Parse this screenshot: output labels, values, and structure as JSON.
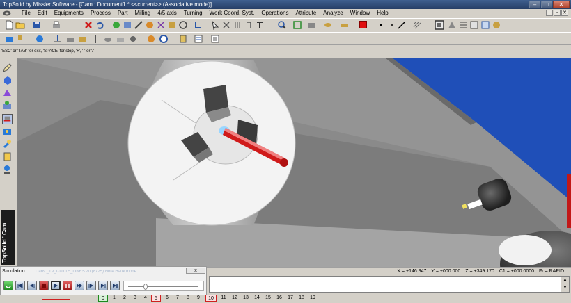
{
  "window": {
    "title": "TopSolid by Missler Software - [Cam : Document1 *  <<current>> (Associative mode)]"
  },
  "menu": [
    "File",
    "Edit",
    "Equipments",
    "Process",
    "Part",
    "Milling",
    "4/5 axis",
    "Turning",
    "Work Coord. Syst.",
    "Operations",
    "Attribute",
    "Analyze",
    "Window",
    "Help"
  ],
  "prompt": "'ESC' or 'TAB' for exit, 'SPACE' for stop, '+', '-' or '/'",
  "sidebar": {
    "mode_label": "TopSolid ' Cam"
  },
  "status": {
    "x": "X = +146.947",
    "y": "Y = +000.000",
    "z": "Z = +349.170",
    "c1": "C1 = +000.0000",
    "fr": "Fr = RAPID"
  },
  "simulation": {
    "title": "Simulation",
    "ghost_text": "Dans _TV_CUTTE_LINES 20 (8725)  Nbre  Hauk  mode",
    "close_label": "x"
  },
  "pages": [
    "0",
    "1",
    "2",
    "3",
    "4",
    "5",
    "6",
    "7",
    "8",
    "9",
    "10",
    "11",
    "12",
    "13",
    "14",
    "15",
    "16",
    "17",
    "18",
    "19"
  ],
  "colors": {
    "title_bar": "#2f4a78",
    "background_blue": "#1f4fb8",
    "sim_red": "#c21818",
    "tool_red": "#d01a1a",
    "active_page_green": "#1d8a1d",
    "active_page_red": "#d02020"
  }
}
